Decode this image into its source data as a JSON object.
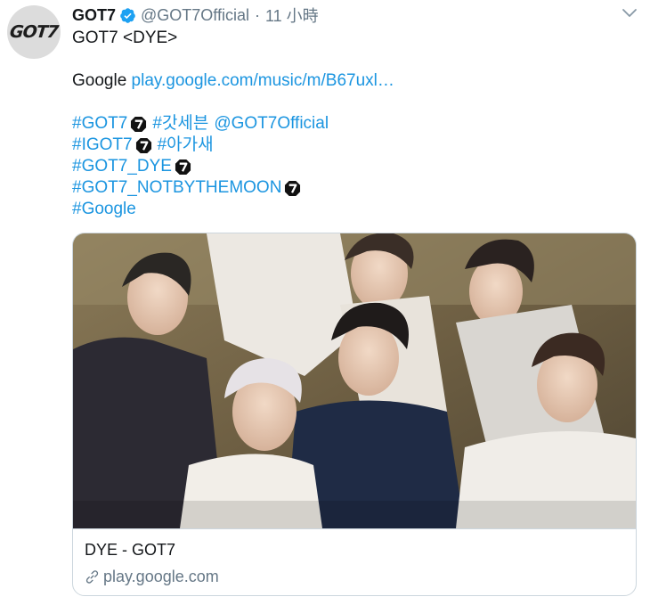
{
  "tweet": {
    "display_name": "GOT7",
    "handle": "@GOT7Official",
    "separator": "·",
    "time": "11 小時",
    "avatar_logo": "GOT7",
    "lines": {
      "l1": "GOT7 <DYE>",
      "l2_prefix": "Google ",
      "l2_link": "play.google.com/music/m/B67uxl…",
      "l3_tag1": "#GOT7",
      "l3_tag2": "#갓세븐",
      "l3_mention": "@GOT7Official",
      "l4_tag1": "#IGOT7",
      "l4_tag2": "#아가새",
      "l5_tag": "#GOT7_DYE",
      "l6_tag": "#GOT7_NOTBYTHEMOON",
      "l7_tag": "#Google"
    }
  },
  "card": {
    "title": "DYE - GOT7",
    "domain": "play.google.com",
    "image_icon": "group-photo-image"
  },
  "icons": {
    "verified": "verified-badge-icon",
    "menu": "chevron-down-icon",
    "got7_emoji": "got7-hashflag-icon",
    "link": "link-icon"
  },
  "colors": {
    "link": "#1b95e0",
    "secondary_text": "#657786",
    "verified": "#1da1f2",
    "border": "#ccd6dd"
  }
}
